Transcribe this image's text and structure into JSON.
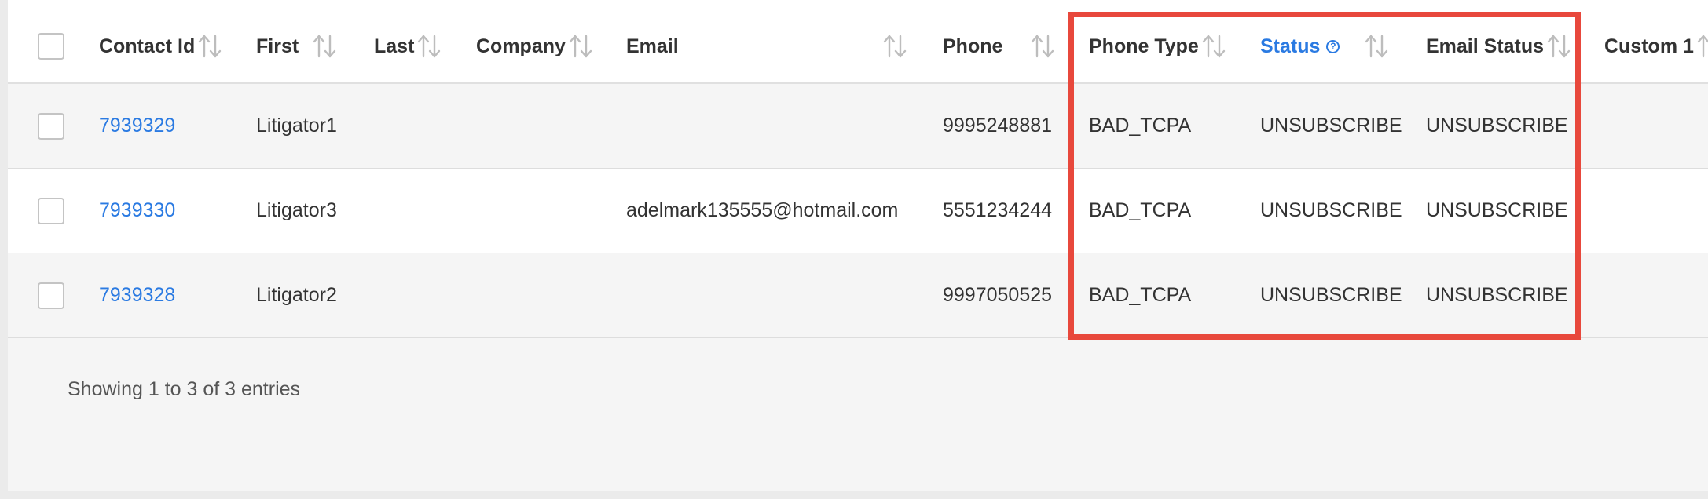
{
  "table": {
    "columns": [
      {
        "key": "select",
        "label": ""
      },
      {
        "key": "contact_id",
        "label": "Contact Id"
      },
      {
        "key": "first",
        "label": "First"
      },
      {
        "key": "last",
        "label": "Last"
      },
      {
        "key": "company",
        "label": "Company"
      },
      {
        "key": "email",
        "label": "Email"
      },
      {
        "key": "phone",
        "label": "Phone"
      },
      {
        "key": "phone_type",
        "label": "Phone Type"
      },
      {
        "key": "status",
        "label": "Status"
      },
      {
        "key": "email_status",
        "label": "Email Status"
      },
      {
        "key": "custom1",
        "label": "Custom 1"
      }
    ],
    "rows": [
      {
        "contact_id": "7939329",
        "first": "Litigator1",
        "last": "",
        "company": "",
        "email": "",
        "phone": "9995248881",
        "phone_type": "BAD_TCPA",
        "status": "UNSUBSCRIBE",
        "email_status": "UNSUBSCRIBE",
        "custom1": ""
      },
      {
        "contact_id": "7939330",
        "first": "Litigator3",
        "last": "",
        "company": "",
        "email": "adelmark135555@hotmail.com",
        "phone": "5551234244",
        "phone_type": "BAD_TCPA",
        "status": "UNSUBSCRIBE",
        "email_status": "UNSUBSCRIBE",
        "custom1": ""
      },
      {
        "contact_id": "7939328",
        "first": "Litigator2",
        "last": "",
        "company": "",
        "email": "",
        "phone": "9997050525",
        "phone_type": "BAD_TCPA",
        "status": "UNSUBSCRIBE",
        "email_status": "UNSUBSCRIBE",
        "custom1": ""
      }
    ]
  },
  "footer": {
    "entries_text": "Showing 1 to 3 of 3 entries"
  },
  "colors": {
    "link": "#2a7ae2",
    "highlight": "#e8483c",
    "sort_arrow": "#bdbdbd"
  },
  "icons": {
    "status_help": "help-circle-icon",
    "sort": "sort-arrows-icon"
  }
}
